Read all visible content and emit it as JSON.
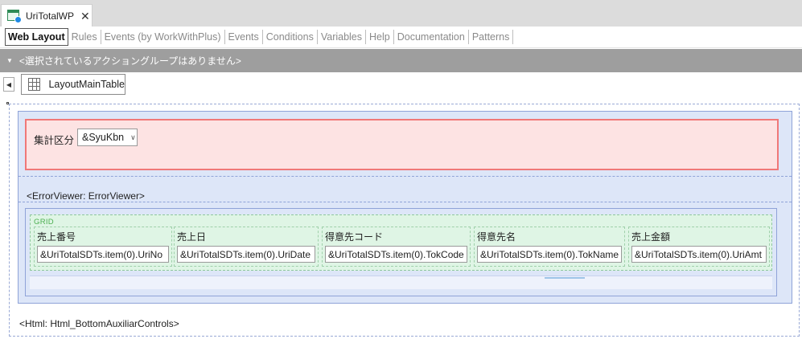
{
  "document_tab": {
    "title": "UriTotalWP",
    "close": "✕"
  },
  "view_tabs": [
    {
      "label": "Web Layout",
      "active": true
    },
    {
      "label": "Rules",
      "active": false
    },
    {
      "label": "Events (by WorkWithPlus)",
      "active": false
    },
    {
      "label": "Events",
      "active": false
    },
    {
      "label": "Conditions",
      "active": false
    },
    {
      "label": "Variables",
      "active": false
    },
    {
      "label": "Help",
      "active": false
    },
    {
      "label": "Documentation",
      "active": false
    },
    {
      "label": "Patterns",
      "active": false
    }
  ],
  "action_bar": {
    "text": "<選択されているアクショングループはありません>"
  },
  "selector": {
    "label": "LayoutMainTable",
    "icon": "table-grid-icon"
  },
  "filter": {
    "label": "集計区分",
    "combo_value": "&SyuKbn",
    "combo_chevron": "∨"
  },
  "error_viewer": {
    "text": "<ErrorViewer: ErrorViewer>"
  },
  "grid": {
    "tag": "GRID",
    "columns": [
      {
        "header": "売上番号",
        "field": "&UriTotalSDTs.item(0).UriNo"
      },
      {
        "header": "売上日",
        "field": "&UriTotalSDTs.item(0).UriDate"
      },
      {
        "header": "得意先コード",
        "field": "&UriTotalSDTs.item(0).TokCode"
      },
      {
        "header": "得意先名",
        "field": "&UriTotalSDTs.item(0).TokName"
      },
      {
        "header": "売上金額",
        "field": "&UriTotalSDTs.item(0).UriAmt"
      }
    ]
  },
  "bottom_html": {
    "text": "<Html: Html_BottomAuxiliarControls>"
  },
  "colors": {
    "action_bar_bg": "#9e9e9e",
    "filter_panel_bg": "#fde3e3",
    "filter_panel_border": "#f07878",
    "layout_bg": "#dde6f8",
    "grid_bg": "#dff5e5",
    "grid_tag": "#4caf50"
  }
}
